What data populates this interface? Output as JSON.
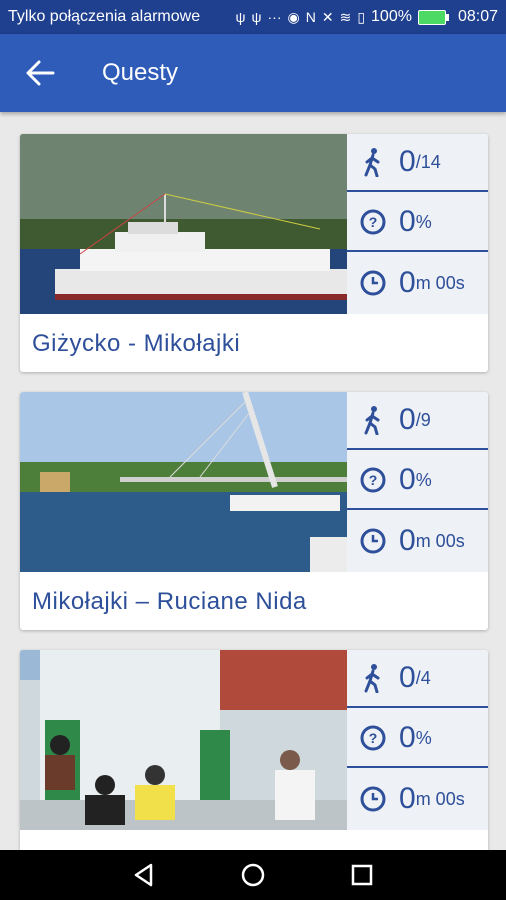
{
  "status_bar": {
    "left_text": "Tylko połączenia alarmowe",
    "battery": "100%",
    "time": "08:07"
  },
  "app_bar": {
    "title": "Questy"
  },
  "quests": [
    {
      "name": "Giżycko - Mikołajki",
      "steps_done": "0",
      "steps_total": "/14",
      "percent": "0",
      "percent_unit": "%",
      "time_min": "0",
      "time_rest": "m 00s"
    },
    {
      "name": "Mikołajki – Ruciane Nida",
      "steps_done": "0",
      "steps_total": "/9",
      "percent": "0",
      "percent_unit": "%",
      "time_min": "0",
      "time_rest": "m 00s"
    },
    {
      "name": "",
      "steps_done": "0",
      "steps_total": "/4",
      "percent": "0",
      "percent_unit": "%",
      "time_min": "0",
      "time_rest": "m 00s"
    }
  ],
  "colors": {
    "status_bar": "#1f3f8f",
    "app_bar": "#2e5cb8",
    "accent": "#2e4f9a"
  }
}
